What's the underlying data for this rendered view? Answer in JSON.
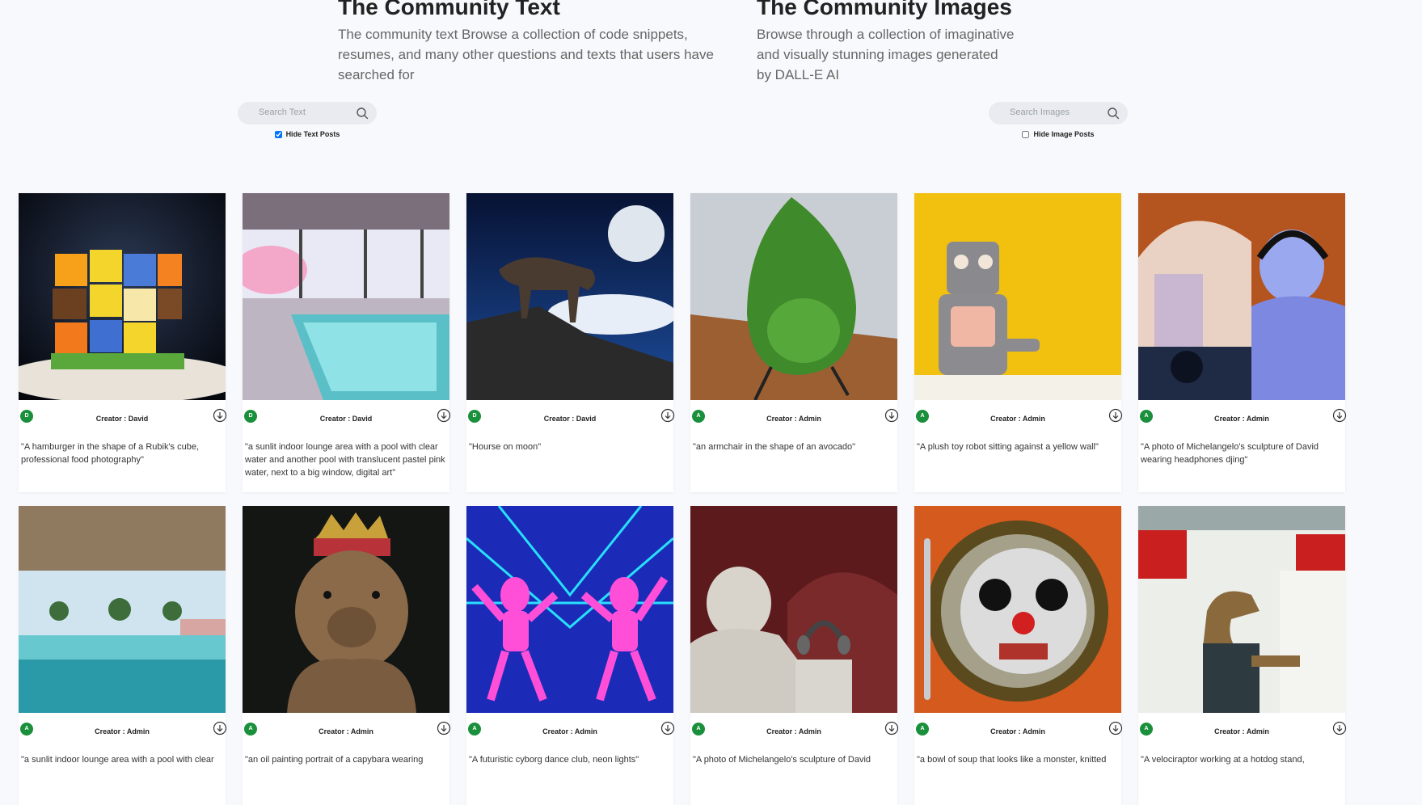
{
  "text_section": {
    "title": "The Community Text",
    "description": "The community text Browse a collection of code snippets, resumes, and many other questions and texts that users have searched for",
    "search_placeholder": "Search Text",
    "hide_label": "Hide Text Posts",
    "hide_checked": true
  },
  "image_section": {
    "title": "The Community Images",
    "description_lines": [
      "Browse through a collection of imaginative",
      "and visually stunning images generated",
      "by DALL-E AI"
    ],
    "search_placeholder": "Search Images",
    "hide_label": "Hide Image Posts",
    "hide_checked": false
  },
  "icons": {
    "search": "search-icon",
    "download": "download-icon"
  },
  "colors": {
    "avatar_green": "#1a8f3c",
    "background": "#f8f9fc"
  },
  "cards": [
    {
      "initial": "D",
      "creator": "Creator : David",
      "prompt": "\"A hamburger in the shape of a Rubik's cube, professional food photography\""
    },
    {
      "initial": "D",
      "creator": "Creator : David",
      "prompt": "\"a sunlit indoor lounge area with a pool with clear water and another pool with translucent pastel pink water, next to a big window, digital art\""
    },
    {
      "initial": "D",
      "creator": "Creator : David",
      "prompt": "\"Hourse on moon\""
    },
    {
      "initial": "A",
      "creator": "Creator : Admin",
      "prompt": "\"an armchair in the shape of an avocado\""
    },
    {
      "initial": "A",
      "creator": "Creator : Admin",
      "prompt": "\"A plush toy robot sitting against a yellow wall\""
    },
    {
      "initial": "A",
      "creator": "Creator : Admin",
      "prompt": "\"A photo of Michelangelo's sculpture of David wearing headphones djing\""
    },
    {
      "initial": "A",
      "creator": "Creator : Admin",
      "prompt": "\"a sunlit indoor lounge area with a pool with clear"
    },
    {
      "initial": "A",
      "creator": "Creator : Admin",
      "prompt": "\"an oil painting portrait of a capybara wearing"
    },
    {
      "initial": "A",
      "creator": "Creator : Admin",
      "prompt": "\"A futuristic cyborg dance club, neon lights\""
    },
    {
      "initial": "A",
      "creator": "Creator : Admin",
      "prompt": "\"A photo of Michelangelo's sculpture of David"
    },
    {
      "initial": "A",
      "creator": "Creator : Admin",
      "prompt": "\"a bowl of soup that looks like a monster, knitted"
    },
    {
      "initial": "A",
      "creator": "Creator : Admin",
      "prompt": "\"A velociraptor working at a hotdog stand,"
    }
  ]
}
